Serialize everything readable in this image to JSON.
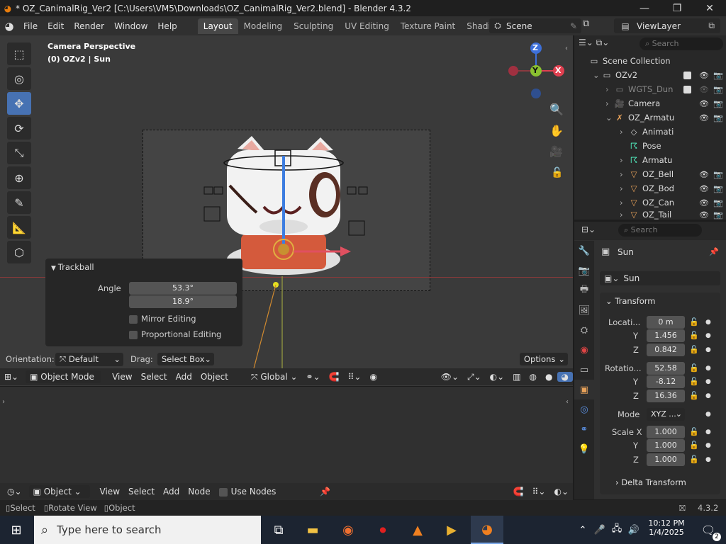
{
  "window": {
    "title": "* OZ_CanimalRig_Ver2 [C:\\Users\\VM5\\Downloads\\OZ_CanimalRig_Ver2.blend] - Blender 4.3.2",
    "minimize": "—",
    "maximize": "❐",
    "close": "✕"
  },
  "menubar": {
    "items": [
      "File",
      "Edit",
      "Render",
      "Window",
      "Help"
    ],
    "workspaces": [
      "Layout",
      "Modeling",
      "Sculpting",
      "UV Editing",
      "Texture Paint",
      "Shading"
    ],
    "scene_label": "Scene",
    "viewlayer_label": "ViewLayer"
  },
  "viewport": {
    "title": "Camera Perspective",
    "subtitle": "(0) OZv2 | Sun",
    "gizmo": {
      "z": "Z",
      "y": "Y",
      "x": "X"
    },
    "orientation_label": "Orientation:",
    "orientation_value": "Default",
    "drag_label": "Drag:",
    "drag_value": "Select Box",
    "options_label": "Options",
    "header": {
      "mode": "Object Mode",
      "menus": [
        "View",
        "Select",
        "Add",
        "Object"
      ],
      "transform": "Global"
    }
  },
  "trackball": {
    "title": "Trackball",
    "angle_label": "Angle",
    "angle_1": "53.3°",
    "angle_2": "18.9°",
    "mirror_label": "Mirror Editing",
    "proportional_label": "Proportional Editing"
  },
  "outliner": {
    "search_placeholder": "Search",
    "rows": [
      {
        "label": "Scene Collection"
      },
      {
        "label": "OZv2"
      },
      {
        "label": "WGTS_Dun"
      },
      {
        "label": "Camera"
      },
      {
        "label": "OZ_Armatu"
      },
      {
        "label": "Animati"
      },
      {
        "label": "Pose"
      },
      {
        "label": "Armatu"
      },
      {
        "label": "OZ_Bell"
      },
      {
        "label": "OZ_Bod"
      },
      {
        "label": "OZ_Can"
      },
      {
        "label": "OZ_Tail"
      }
    ]
  },
  "properties": {
    "search_placeholder": "Search",
    "object_name": "Sun",
    "object_field": "Sun",
    "transform_title": "Transform",
    "location_label": "Locati...",
    "loc_x": "0 m",
    "loc_y": "1.456",
    "loc_z": "0.842",
    "rotation_label": "Rotatio...",
    "rot_x": "52.58",
    "rot_y": "-8.12",
    "rot_z": "16.36",
    "mode_label": "Mode",
    "mode_value": "XYZ ...",
    "scale_label": "Scale X",
    "scale_x": "1.000",
    "scale_y": "1.000",
    "scale_z": "1.000",
    "y_label": "Y",
    "z_label": "Z",
    "delta_title": "Delta Transform"
  },
  "node_editor": {
    "type": "Object",
    "menus": [
      "View",
      "Select",
      "Add",
      "Node"
    ],
    "use_nodes_label": "Use Nodes"
  },
  "statusbar": {
    "select": "Select",
    "rotate": "Rotate View",
    "object": "Object",
    "version": "4.3.2"
  },
  "taskbar": {
    "search_placeholder": "Type here to search",
    "time": "10:12 PM",
    "date": "1/4/2025",
    "notifications": "2"
  }
}
